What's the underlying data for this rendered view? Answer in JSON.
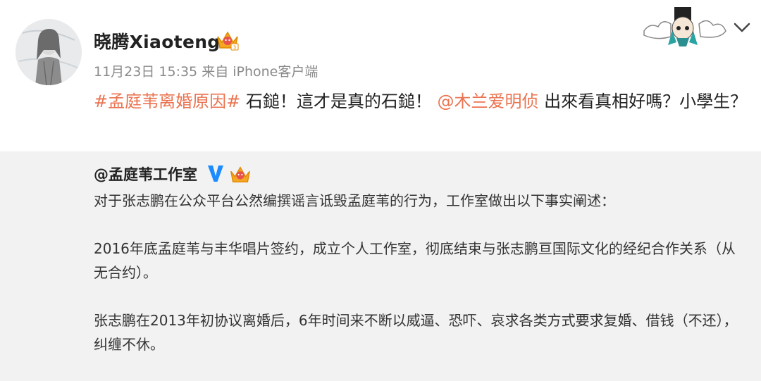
{
  "post": {
    "username": "晓腾Xiaoteng",
    "meta": "11月23日 15:35 来自 iPhone客户端",
    "hashtag": "#孟庭苇离婚原因#",
    "text_1": " 石鎚！這才是真的石鎚！",
    "mention": "@木兰爱明侦",
    "text_2": " 出來看真相好嗎？小學生？"
  },
  "quoted": {
    "author": "@孟庭苇工作室",
    "paragraphs": [
      "对于张志鹏在公众平台公然编撰谣言诋毁孟庭苇的行为，工作室做出以下事实阐述：",
      "2016年底孟庭苇与丰华唱片签约，成立个人工作室，彻底结束与张志鹏亘国际文化的经纪合作关系（从无合约）。",
      "张志鹏在2013年初协议离婚后，6年时间来不断以威逼、恐吓、哀求各类方式要求复婚、借钱（不还），纠缠不休。"
    ]
  },
  "colors": {
    "accent": "#eb7350",
    "verified": "#1a8cff",
    "quote_bg": "#f2f2f2"
  },
  "icons": {
    "vip": "crown-vip-icon",
    "verified": "verified-v-icon",
    "more": "chevron-down-icon"
  }
}
